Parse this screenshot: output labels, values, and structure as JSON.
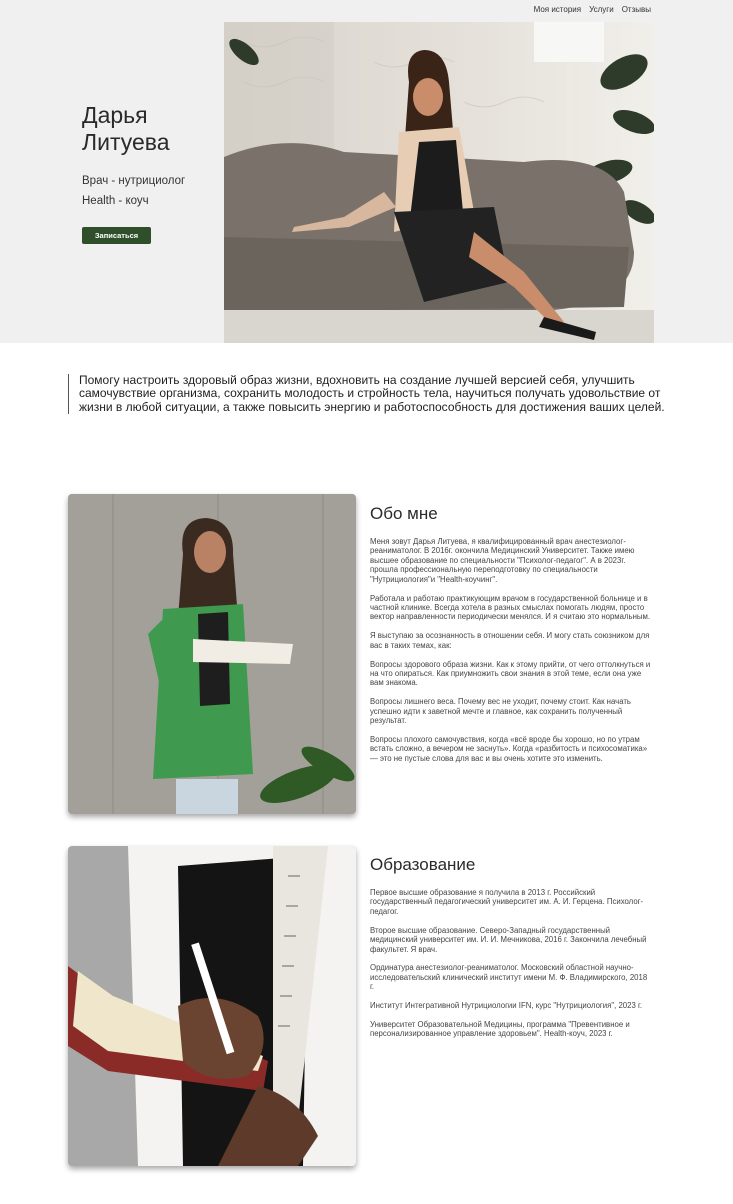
{
  "nav": {
    "items": [
      "Моя история",
      "Услуги",
      "Отзывы"
    ]
  },
  "hero": {
    "name_line1": "Дарья",
    "name_line2": "Литуева",
    "role1": "Врач - нутрициолог",
    "role2": "Health - коуч",
    "cta_label": "Записаться"
  },
  "quote": "Помогу настроить здоровый образ жизни, вдохновить на создание лучшей версией себя, улучшить самочувствие организма, сохранить молодость и стройность тела, научиться получать удовольствие от жизни в любой ситуации, а также повысить энергию и работоспособность для достижения ваших целей.",
  "about": {
    "title": "Обо мне",
    "paragraphs": [
      "Меня зовут Дарья Литуева, я квалифицированный врач анестезиолог-реаниматолог. В 2016г. окончила Медицинский Университет. Также имею высшее образование по специальности \"Психолог-педагог\". А в 2023г. прошла профессиональную переподготовку по специальности \"Нутрициология\"и \"Health-коучинг\".",
      "Работала и работаю практикующим врачом в государственной больнице и в частной клинике. Всегда хотела в разных смыслах помогать людям, просто вектор направленности периодически менялся. И я считаю это нормальным.",
      "Я выступаю за осознанность в отношении себя. И могу стать союзником для вас в таких темах, как:",
      "Вопросы здорового образа жизни. Как к этому прийти, от чего оттолкнуться и на что опираться. Как приумножить свои знания в этой теме, если она уже вам знакома.",
      "Вопросы лишнего веса. Почему вес не уходит, почему стоит. Как начать успешно идти к заветной мечте и главное, как сохранить полученный результат.",
      "Вопросы плохого самочувствия, когда «всё вроде бы хорошо, но по утрам встать сложно, а вечером не заснуть». Когда «разбитость и психосоматика» — это не пустые слова для вас и вы очень хотите это изменить."
    ]
  },
  "education": {
    "title": "Образование",
    "paragraphs": [
      "Первое высшие образование я получила в 2013 г. Российский государственный педагогический университет им. А. И. Герцена. Психолог-педагог.",
      "Второе высшие образование. Северо-Западный государственный медицинский университет им. И. И. Мечникова, 2016 г. Закончила лечебный факультет. Я врач.",
      "Ординатура анестезиолог-реаниматолог. Московский областной научно-исследовательский клинический институт имени М. Ф. Владимирского, 2018 г.",
      "Институт Интегративной Нутрициологии IFN, курс \"Нутрициология\", 2023 г.",
      "Университет Образовательной Медицины, программа \"Превентивное и персонализированное управление здоровьем\". Health-коуч, 2023 г."
    ]
  },
  "colors": {
    "hero_bg": "#f0f0f0",
    "cta_bg": "#2f4f2b",
    "jacket_green": "#3f9a4f"
  }
}
